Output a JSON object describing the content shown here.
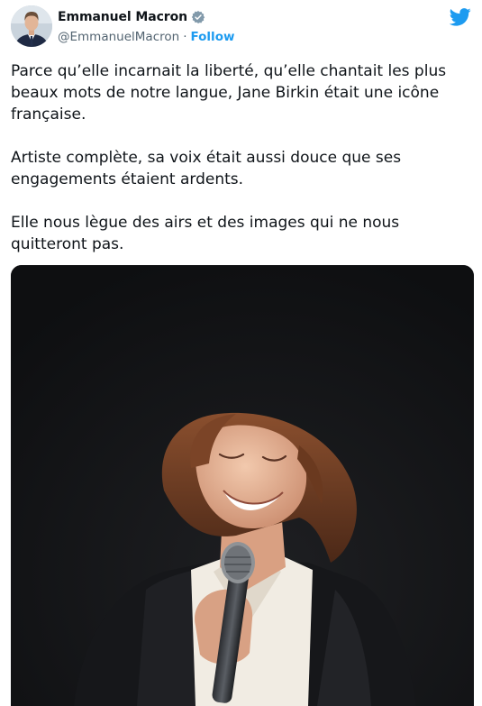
{
  "author": {
    "display_name": "Emmanuel Macron",
    "handle": "@EmmanuelMacron",
    "separator": "·",
    "follow_label": "Follow",
    "verified_icon": "verified-badge-icon",
    "avatar": "author-avatar"
  },
  "brand": {
    "icon": "twitter-bird-icon",
    "color": "#1d9bf0"
  },
  "tweet": {
    "paragraphs": [
      "Parce qu’elle incarnait la liberté, qu’elle chantait les plus beaux mots de notre langue, Jane Birkin était une icône française.",
      "Artiste complète, sa voix était aussi douce que ses engagements étaient ardents.",
      "Elle nous lègue des airs et des images qui ne nous quitteront pas."
    ]
  },
  "media": {
    "type": "photo",
    "subject": "tweet-photo"
  },
  "colors": {
    "text": "#0f1419",
    "secondary_text": "#536471",
    "link": "#1d9bf0",
    "photo_background": "#141517"
  }
}
